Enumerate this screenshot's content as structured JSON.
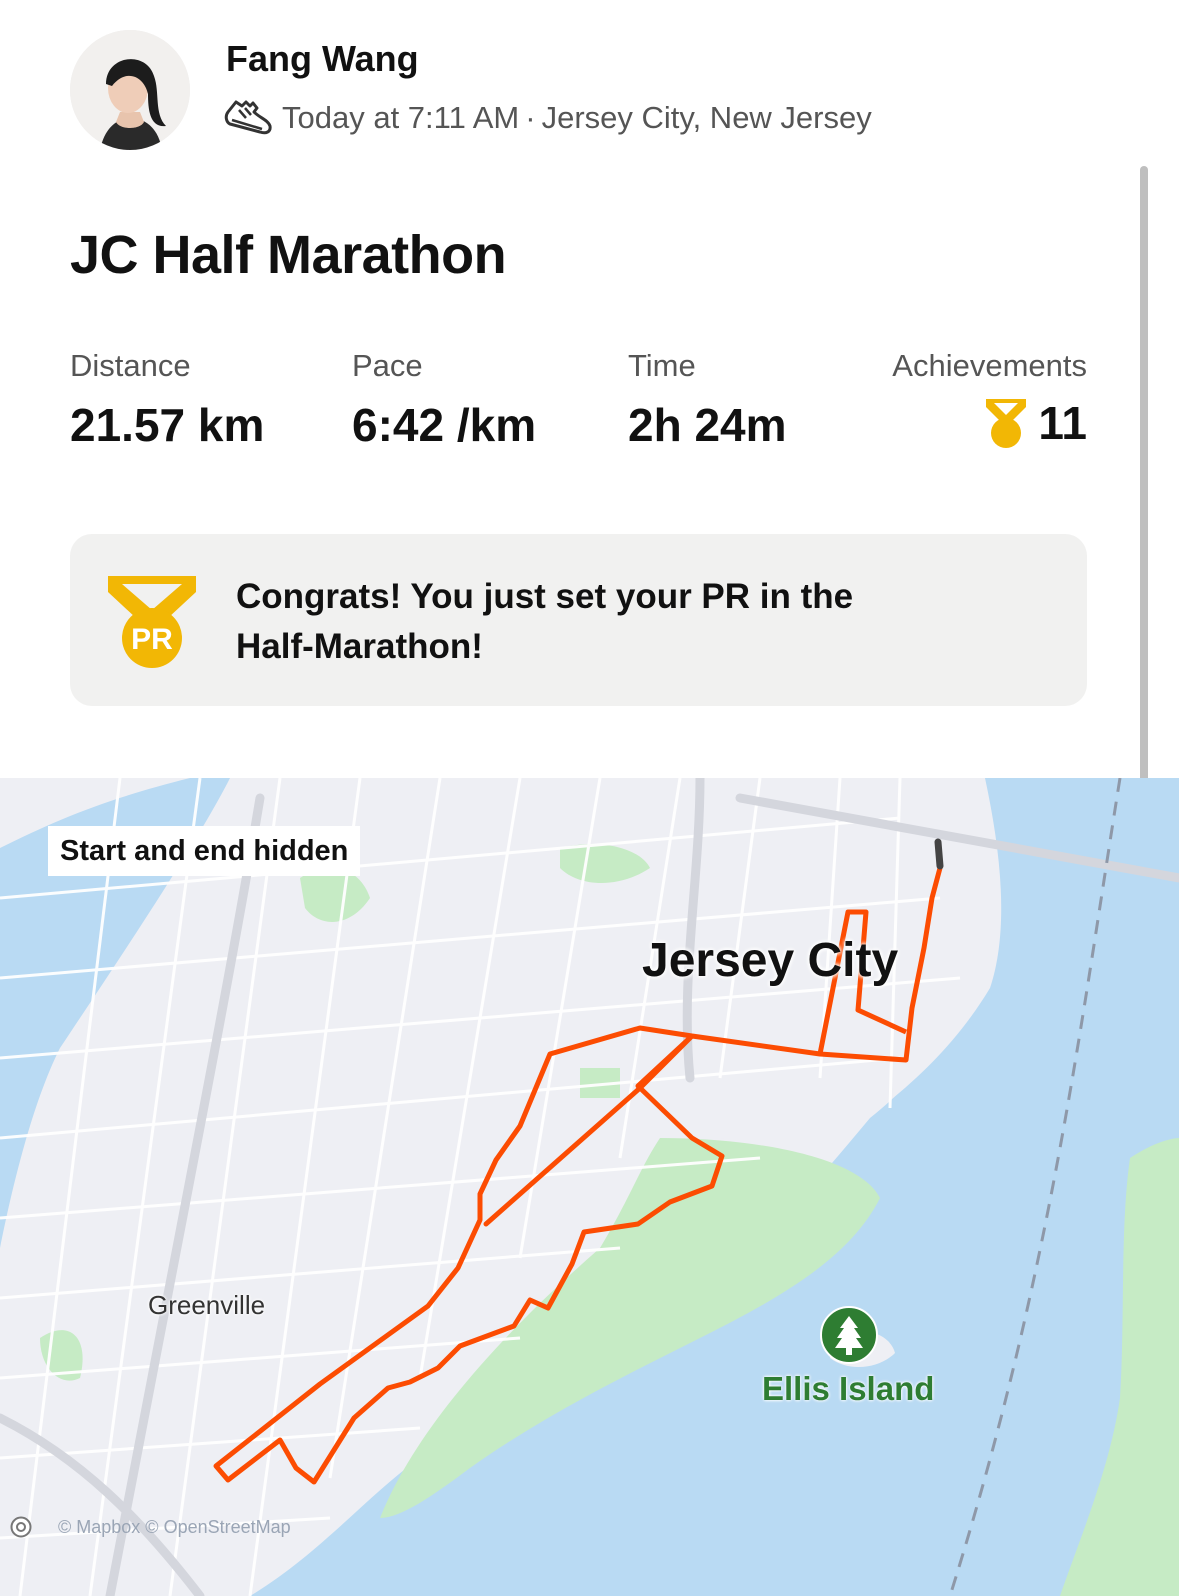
{
  "header": {
    "athlete_name": "Fang Wang",
    "activity_icon": "running-shoe-icon",
    "timestamp": "Today at 7:11 AM",
    "separator": "·",
    "location": "Jersey City, New Jersey"
  },
  "activity": {
    "title": "JC Half Marathon"
  },
  "stats": {
    "distance": {
      "label": "Distance",
      "value": "21.57 km"
    },
    "pace": {
      "label": "Pace",
      "value": "6:42 /km"
    },
    "time": {
      "label": "Time",
      "value": "2h 24m"
    },
    "achievements": {
      "label": "Achievements",
      "value": "11",
      "icon": "medal-icon"
    }
  },
  "pr_banner": {
    "icon": "pr-medal-icon",
    "line1": "Congrats! You just set your PR in the",
    "line2": "Half-Marathon!"
  },
  "map": {
    "privacy_badge": "Start and end hidden",
    "labels": {
      "city": "Jersey City",
      "neighborhood": "Greenville",
      "landmark": "Ellis Island"
    },
    "attribution": "© Mapbox © OpenStreetMap"
  },
  "colors": {
    "route": "#fc4c02",
    "medal": "#f2b705",
    "water": "#b9daf3",
    "park": "#c6ebc5",
    "land": "#eeeff4"
  }
}
